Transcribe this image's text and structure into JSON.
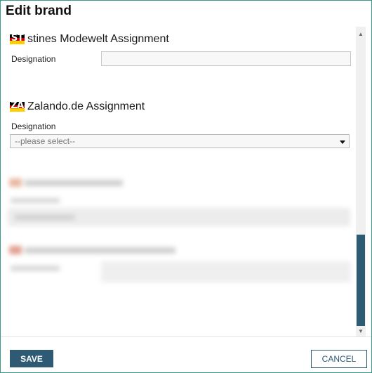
{
  "dialog": {
    "title": "Edit brand"
  },
  "sections": [
    {
      "flag_code": "ST",
      "title": "stines Modewelt Assignment",
      "field_label": "Designation",
      "field_value": ""
    },
    {
      "flag_code": "ZA",
      "title": "Zalando.de Assignment",
      "field_label": "Designation",
      "select_value": "--please select--"
    }
  ],
  "footer": {
    "save_label": "SAVE",
    "cancel_label": "CANCEL"
  },
  "colors": {
    "accent": "#2e5a73",
    "dialog_border": "#3a9a8a",
    "flag_black": "#000000",
    "flag_red": "#dd0000",
    "flag_gold": "#ffce00"
  }
}
